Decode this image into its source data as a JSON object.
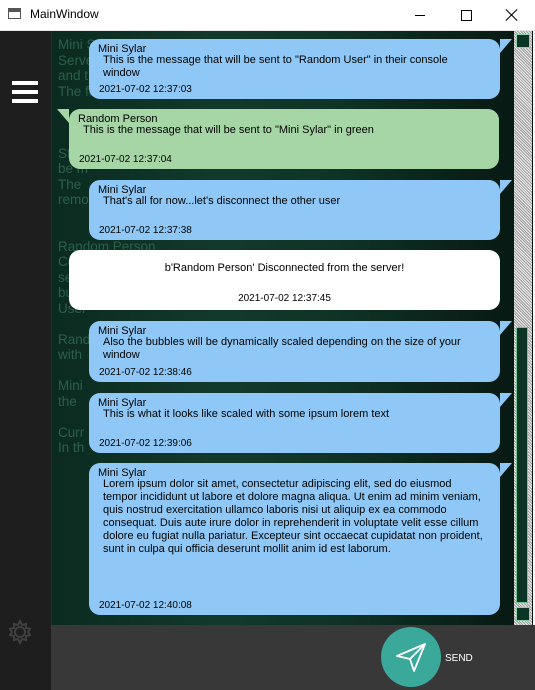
{
  "window": {
    "title": "MainWindow"
  },
  "background_text": "Mini Sylar\nServer\nand t\nThe font size will also be changed after\n\n\n\nStarting date and time also in the bottom corner (time stamp) that\nbe m\nThe\nremo\n\n\nRandom Person\nColor\nserv\nbut\nUser\n\nRand\nwith\n\nMini\nthe\n\nCurr\nIn th",
  "messages": [
    {
      "sender": "Mini Sylar",
      "text": "This is the message that will be sent to \"Random User\" in their console window",
      "time": "2021-07-02 12:37:03"
    },
    {
      "sender": "Random Person",
      "text": "This is the message that will be sent to \"Mini Sylar\" in green",
      "time": "2021-07-02 12:37:04"
    },
    {
      "sender": "Mini Sylar",
      "text": "That's all for now...let's disconnect the other user",
      "time": "2021-07-02 12:37:38"
    },
    {
      "sender": "",
      "text": "b'Random Person' Disconnected from the server!",
      "time": "2021-07-02 12:37:45"
    },
    {
      "sender": "Mini Sylar",
      "text": "Also the bubbles will be dynamically scaled depending on the size of your window",
      "time": "2021-07-02 12:38:46"
    },
    {
      "sender": "Mini Sylar",
      "text": "This is what it looks like scaled with some ipsum lorem text",
      "time": "2021-07-02 12:39:06"
    },
    {
      "sender": "Mini Sylar",
      "text": "Lorem ipsum dolor sit amet, consectetur adipiscing elit, sed do eiusmod tempor incididunt ut labore et dolore magna aliqua. Ut enim ad minim veniam, quis nostrud exercitation ullamco laboris nisi ut aliquip ex ea commodo consequat. Duis aute irure dolor in reprehenderit in voluptate velit esse cillum dolore eu fugiat nulla pariatur. Excepteur sint occaecat cupidatat non proident, sunt in culpa qui officia deserunt mollit anim id est laborum.",
      "time": "2021-07-02 12:40:08"
    }
  ],
  "send": {
    "label": "SEND"
  },
  "icons": {
    "menu": "hamburger-icon",
    "settings": "gear-icon",
    "send": "paper-plane-icon"
  },
  "colors": {
    "own_bubble": "#8fc8f6",
    "other_bubble": "#a6d6a6",
    "system_bubble": "#ffffff",
    "send_button": "#3aa89a"
  }
}
